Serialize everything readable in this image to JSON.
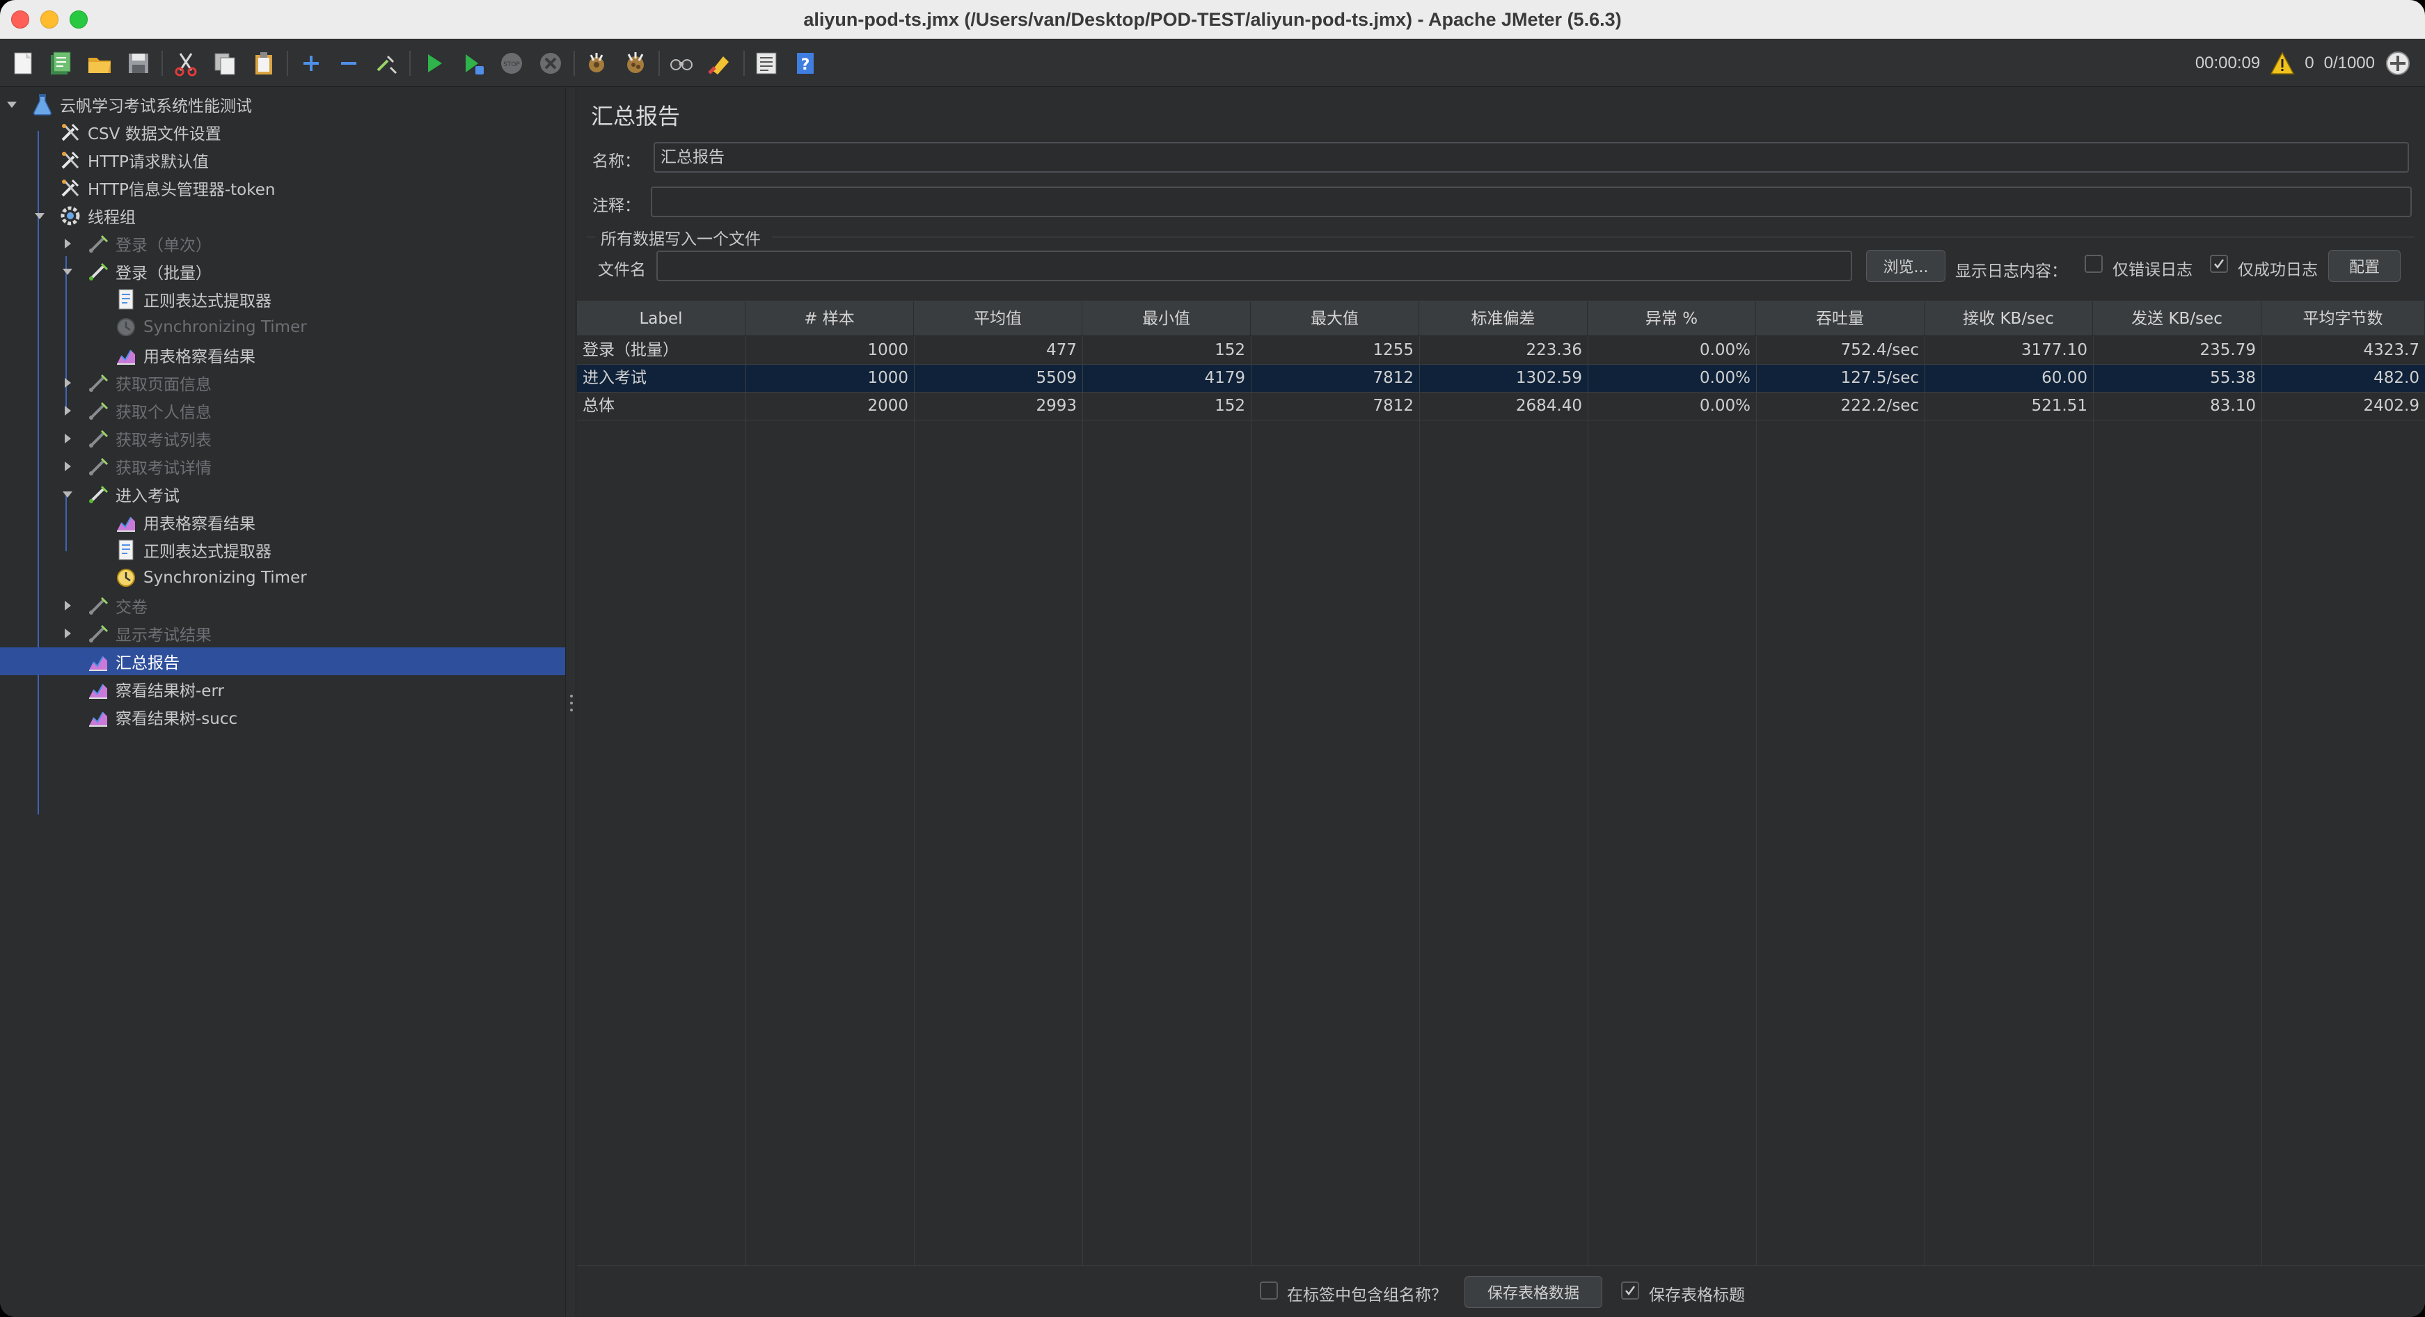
{
  "window": {
    "title": "aliyun-pod-ts.jmx (/Users/van/Desktop/POD-TEST/aliyun-pod-ts.jmx) - Apache JMeter (5.6.3)"
  },
  "toolbar": {
    "elapsed": "00:00:09",
    "warning_count": "0",
    "threads": "0/1000",
    "buttons": [
      "new-icon",
      "templates-icon",
      "open-icon",
      "save-icon",
      "cut-icon",
      "copy-icon",
      "paste-icon",
      "expand-icon",
      "collapse-icon",
      "toggle-icon",
      "start-icon",
      "start-no-pause-icon",
      "stop-icon",
      "shutdown-icon",
      "clear-icon",
      "clear-all-icon",
      "search-icon",
      "reset-search-icon",
      "function-helper-icon",
      "help-icon"
    ]
  },
  "tree": {
    "items": [
      {
        "label": "云帆学习考试系统性能测试",
        "icon": "test-plan-icon",
        "disabled": false
      },
      {
        "label": "CSV 数据文件设置",
        "icon": "config-element-icon",
        "disabled": false
      },
      {
        "label": "HTTP请求默认值",
        "icon": "config-element-icon",
        "disabled": false
      },
      {
        "label": "HTTP信息头管理器-token",
        "icon": "config-element-icon",
        "disabled": false
      },
      {
        "label": "线程组",
        "icon": "thread-group-icon",
        "disabled": false
      },
      {
        "label": "登录（单次）",
        "icon": "sampler-icon",
        "disabled": true
      },
      {
        "label": "登录（批量）",
        "icon": "sampler-icon",
        "disabled": false
      },
      {
        "label": "正则表达式提取器",
        "icon": "extractor-icon",
        "disabled": false
      },
      {
        "label": "Synchronizing Timer",
        "icon": "timer-icon",
        "disabled": true
      },
      {
        "label": "用表格察看结果",
        "icon": "listener-icon",
        "disabled": false
      },
      {
        "label": "获取页面信息",
        "icon": "sampler-icon",
        "disabled": true
      },
      {
        "label": "获取个人信息",
        "icon": "sampler-icon",
        "disabled": true
      },
      {
        "label": "获取考试列表",
        "icon": "sampler-icon",
        "disabled": true
      },
      {
        "label": "获取考试详情",
        "icon": "sampler-icon",
        "disabled": true
      },
      {
        "label": "进入考试",
        "icon": "sampler-icon",
        "disabled": false
      },
      {
        "label": "用表格察看结果",
        "icon": "listener-icon",
        "disabled": false
      },
      {
        "label": "正则表达式提取器",
        "icon": "extractor-icon",
        "disabled": false
      },
      {
        "label": "Synchronizing Timer",
        "icon": "timer-icon",
        "disabled": false
      },
      {
        "label": "交卷",
        "icon": "sampler-icon",
        "disabled": true
      },
      {
        "label": "显示考试结果",
        "icon": "sampler-icon",
        "disabled": true
      },
      {
        "label": "汇总报告",
        "icon": "listener-icon",
        "disabled": false
      },
      {
        "label": "察看结果树-err",
        "icon": "listener-icon",
        "disabled": false
      },
      {
        "label": "察看结果树-succ",
        "icon": "listener-icon",
        "disabled": false
      }
    ]
  },
  "panel": {
    "title": "汇总报告",
    "name_label": "名称：",
    "name_value": "汇总报告",
    "comment_label": "注释：",
    "comment_value": "",
    "file_group_title": "所有数据写入一个文件",
    "filename_label": "文件名",
    "filename_value": "",
    "browse_label": "浏览...",
    "log_display_label": "显示日志内容：",
    "errors_only_label": "仅错误日志",
    "errors_only_checked": false,
    "success_only_label": "仅成功日志",
    "success_only_checked": true,
    "configure_label": "配置"
  },
  "table": {
    "columns": [
      "Label",
      "# 样本",
      "平均值",
      "最小值",
      "最大值",
      "标准偏差",
      "异常 %",
      "吞吐量",
      "接收 KB/sec",
      "发送 KB/sec",
      "平均字节数"
    ],
    "rows": [
      [
        "登录（批量）",
        "1000",
        "477",
        "152",
        "1255",
        "223.36",
        "0.00%",
        "752.4/sec",
        "3177.10",
        "235.79",
        "4323.7"
      ],
      [
        "进入考试",
        "1000",
        "5509",
        "4179",
        "7812",
        "1302.59",
        "0.00%",
        "127.5/sec",
        "60.00",
        "55.38",
        "482.0"
      ],
      [
        "总体",
        "2000",
        "2993",
        "152",
        "7812",
        "2684.40",
        "0.00%",
        "222.2/sec",
        "521.51",
        "83.10",
        "2402.9"
      ]
    ]
  },
  "bottom": {
    "include_group_label": "在标签中包含组名称？",
    "include_group_checked": false,
    "save_table_button": "保存表格数据",
    "save_header_label": "保存表格标题",
    "save_header_checked": true
  },
  "colors": {
    "selection": "#2e4f9c",
    "row_highlight": "#0f223a",
    "background": "#2b2d2f"
  }
}
